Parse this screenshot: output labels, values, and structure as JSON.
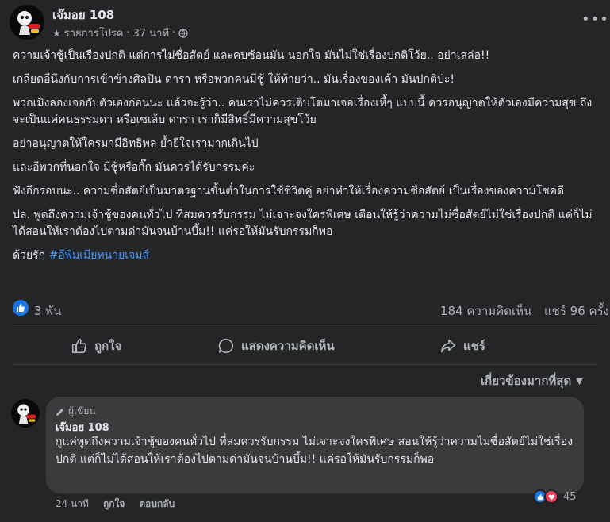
{
  "post": {
    "author": "เจ๊มอย 108",
    "meta_label": "รายการโปรด",
    "meta_sep": "·",
    "time": "37 นาที",
    "paragraphs": [
      "ความเจ้าชู้เป็นเรื่องปกติ แต่การไม่ซื่อสัตย์ และคบซ้อนมัน นอกใจ มันไม่ใช่เรื่องปกติโว้ย.. อย่าเสล่อ!!",
      "เกลียดอีนึงกับการเข้าข้างศิลปิน ดารา หรือพวกคนมีชู้ ให้ท้ายว่า.. มันเรื่องของเค้า มันปกติป่ะ!",
      "พวกเมิงลองเจอกับตัวเองก่อนนะ แล้วจะรู้ว่า.. คนเราไม่ควรเติบโตมาเจอเรื่องเหี้ๆ แบบนี้ ควรอนุญาตให้ตัวเองมีความสุข ถึงจะเป็นแค่คนธรรมดา หรือเซเล้บ ดารา เราก็มีสิทธิ์มีความสุขโว้ย",
      "อย่าอนุญาตให้ใครมามีอิทธิพล ย้ำยีใจเรามากเกินไป",
      "และอีพวกที่นอกใจ มีชู้หรือกิ๊ก มันควรได้รับกรรมค่ะ",
      "ฟังอีกรอบนะ.. ความซื่อสัตย์เป็นมาตรฐานขั้นต่ำในการใช้ชีวิตคู่ อย่าทำให้เรื่องความซื่อสัตย์ เป็นเรื่องของความโชคดี",
      "ปล. พูดถึงความเจ้าชู้ของคนทั่วไป ที่สมควรรับกรรม ไม่เจาะจงใครพิเศษ เตือนให้รู้ว่าความไม่ซื่อสัตย์ไม่ใช่เรื่องปกติ แต่ก็ไม่ได้สอนให้เราต้องไปตามด่ามันจนบ้านบึ้ม!! แค่รอให้มันรับกรรมก็พอ"
    ],
    "signoff": "ด้วยรัก",
    "hashtag": "#อีพิมเมียทนายเจมส์",
    "likes": "3 พัน",
    "comments": "184 ความคิดเห็น",
    "shares": "แชร์ 96 ครั้ง"
  },
  "actions": {
    "like": "ถูกใจ",
    "comment": "แสดงความคิดเห็น",
    "share": "แชร์"
  },
  "sort_label": "เกี่ยวข้องมากที่สุด",
  "comment": {
    "badge": "ผู้เขียน",
    "author": "เจ๊มอย 108",
    "text": "กูแค่พูดถึงความเจ้าชู้ของคนทั่วไป ที่สมควรรับกรรม ไม่เจาะจงใครพิเศษ สอนให้รู้ว่าความไม่ซื่อสัตย์ไม่ใช่เรื่องปกติ แต่ก็ไม่ได้สอนให้เราต้องไปตามด่ามันจนบ้านบึ้ม!! แค่รอให้มันรับกรรมก็พอ",
    "time": "24 นาที",
    "like": "ถูกใจ",
    "reply": "ตอบกลับ",
    "reactions": "45"
  },
  "colors": {
    "accent": "#1b74e4",
    "hashtag": "#4599ff",
    "love": "#f33e58"
  },
  "icons": [
    "star-icon",
    "globe-icon",
    "more-icon",
    "like-icon",
    "comment-icon",
    "share-icon",
    "pencil-icon",
    "love-icon"
  ]
}
